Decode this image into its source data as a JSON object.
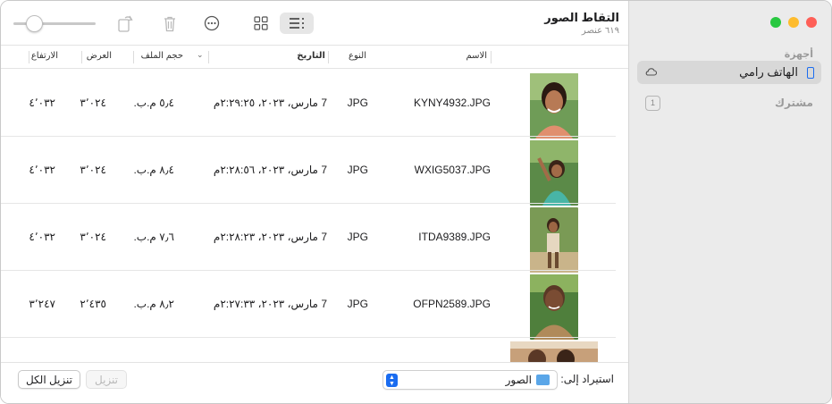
{
  "window": {
    "title": "التقاط الصور",
    "subtitle": "٦١٩ عنصر"
  },
  "sidebar": {
    "devices_header": "أجهزة",
    "device_label": "الهاتف رامي",
    "shared_header": "مشترك",
    "shared_badge": "1"
  },
  "toolbar": {
    "icons": [
      "zoom-slider",
      "rotate-icon",
      "trash-icon",
      "more-icon",
      "grid-view-icon",
      "list-view-icon"
    ]
  },
  "table": {
    "columns": {
      "name": "الاسم",
      "type": "النوع",
      "date": "التاريخ",
      "size": "حجم الملف",
      "width": "العرض",
      "height": "الارتفاع"
    },
    "rows": [
      {
        "name": "KYNY4932.JPG",
        "type": "JPG",
        "date": "7 مارس، ٢٠٢٣، ٢:٢٩:٢٥م",
        "size": "٥٫٤ م.ب.",
        "width": "٣٬٠٢٤",
        "height": "٤٬٠٣٢"
      },
      {
        "name": "WXIG5037.JPG",
        "type": "JPG",
        "date": "7 مارس، ٢٠٢٣، ٢:٢٨:٥٦م",
        "size": "٨٫٤ م.ب.",
        "width": "٣٬٠٢٤",
        "height": "٤٬٠٣٢"
      },
      {
        "name": "ITDA9389.JPG",
        "type": "JPG",
        "date": "7 مارس، ٢٠٢٣، ٢:٢٨:٢٣م",
        "size": "٧٫٦ م.ب.",
        "width": "٣٬٠٢٤",
        "height": "٤٬٠٣٢"
      },
      {
        "name": "OFPN2589.JPG",
        "type": "JPG",
        "date": "7 مارس، ٢٠٢٣، ٢:٢٧:٣٣م",
        "size": "٨٫٢ م.ب.",
        "width": "٢٬٤٣٥",
        "height": "٣٬٢٤٧"
      }
    ]
  },
  "bottom": {
    "import_label": "استيراد إلى:",
    "import_value": "الصور",
    "download_label": "تنزيل",
    "download_all_label": "تنزيل الكل"
  },
  "colors": {
    "accent": "#1a6cf0",
    "sidebar_bg": "#ebebeb",
    "selected_bg": "#d8d8d8"
  }
}
